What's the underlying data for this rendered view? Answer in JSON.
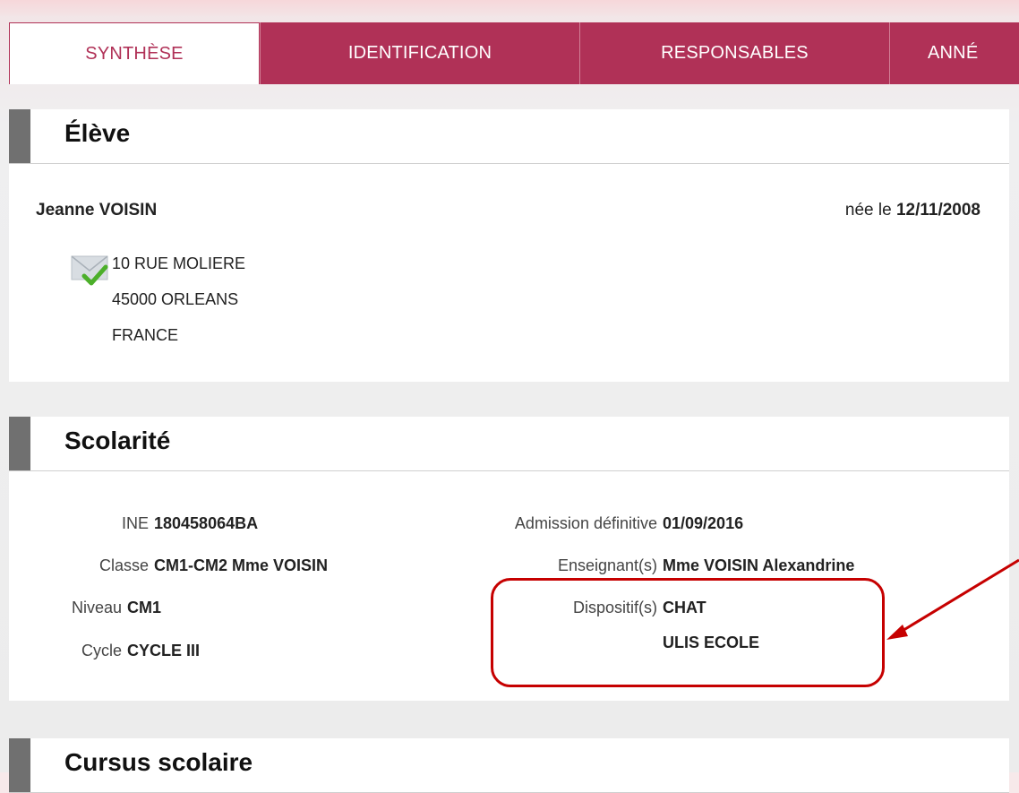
{
  "tabs": [
    {
      "label": "SYNTHÈSE",
      "active": true
    },
    {
      "label": "IDENTIFICATION",
      "active": false
    },
    {
      "label": "RESPONSABLES",
      "active": false
    },
    {
      "label": "ANNÉ",
      "active": false
    }
  ],
  "eleve": {
    "title": "Élève",
    "name": "Jeanne VOISIN",
    "birth_prefix": "née le",
    "birth_date": "12/11/2008",
    "address_icon": "envelope-check-icon",
    "address_lines": [
      "10 RUE MOLIERE",
      "45000 ORLEANS",
      "FRANCE"
    ]
  },
  "scolarite": {
    "title": "Scolarité",
    "ine_label": "INE",
    "ine_value": "180458064BA",
    "classe_label": "Classe",
    "classe_value": "CM1-CM2 Mme VOISIN",
    "niveau_label": "Niveau",
    "niveau_value": "CM1",
    "cycle_label": "Cycle",
    "cycle_value": "CYCLE III",
    "admission_label": "Admission définitive",
    "admission_value": "01/09/2016",
    "enseignants_label": "Enseignant(s)",
    "enseignants_value": "Mme VOISIN Alexandrine",
    "dispositifs_label": "Dispositif(s)",
    "dispositifs_values": [
      "CHAT",
      "ULIS ECOLE"
    ]
  },
  "cursus": {
    "title": "Cursus scolaire"
  },
  "colors": {
    "accent": "#b03157",
    "annotation": "#c60000",
    "header_bar": "#707070"
  }
}
